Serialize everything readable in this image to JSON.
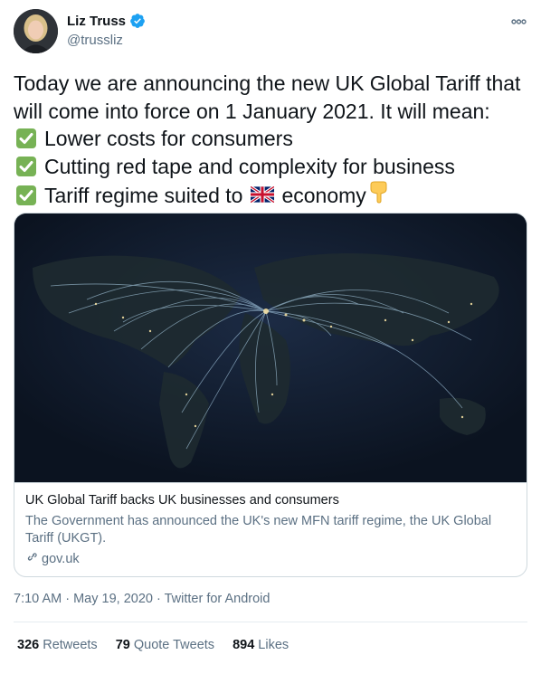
{
  "author": {
    "name": "Liz Truss",
    "handle": "@trussliz"
  },
  "tweet": {
    "line1": "Today we are announcing the new UK Global Tariff that",
    "line2": "will come into force on 1 January 2021. It will mean:",
    "bullets": [
      "Lower costs for consumers",
      "Cutting red tape and complexity for business",
      "Tariff regime suited to"
    ],
    "bullet3_suffix": "economy"
  },
  "card": {
    "title": "UK Global Tariff backs UK businesses and consumers",
    "description": "The Government has announced the UK's new MFN tariff regime, the UK Global Tariff (UKGT).",
    "domain": "gov.uk"
  },
  "meta": {
    "time": "7:10 AM",
    "date": "May 19, 2020",
    "source": "Twitter for Android"
  },
  "stats": {
    "retweets_count": "326",
    "retweets_label": "Retweets",
    "quotes_count": "79",
    "quotes_label": "Quote Tweets",
    "likes_count": "894",
    "likes_label": "Likes"
  },
  "colors": {
    "accent": "#1da1f2",
    "check_green": "#77b255",
    "muted_text": "#5b7083"
  }
}
